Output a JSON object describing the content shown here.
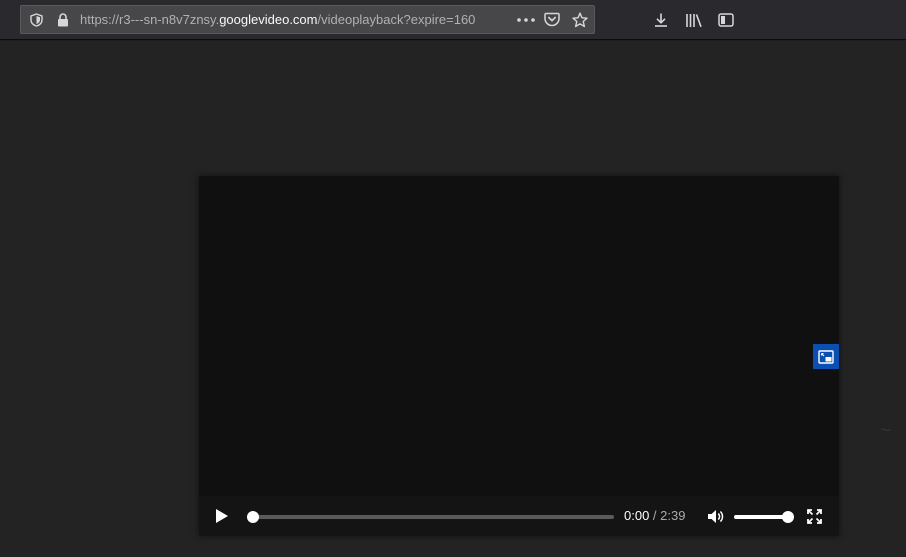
{
  "browser": {
    "url_prefix": "https://r3---sn-n8v7znsy.",
    "url_host": "googlevideo.com",
    "url_suffix": "/videoplayback?expire=160",
    "icons": {
      "tracking": "shield-icon",
      "lock": "lock-icon",
      "page_actions": "more-icon",
      "pocket": "pocket-icon",
      "bookmark": "star-icon",
      "downloads": "download-icon",
      "library": "library-icon",
      "sidebar": "sidebar-icon"
    }
  },
  "video": {
    "current_time": "0:00",
    "separator": " / ",
    "duration": "2:39",
    "progress": 0,
    "volume": 1.0,
    "icons": {
      "play": "play-icon",
      "mute": "volume-icon",
      "fullscreen": "fullscreen-icon",
      "pip": "picture-in-picture-icon"
    },
    "accent": "#0b4fb3"
  }
}
